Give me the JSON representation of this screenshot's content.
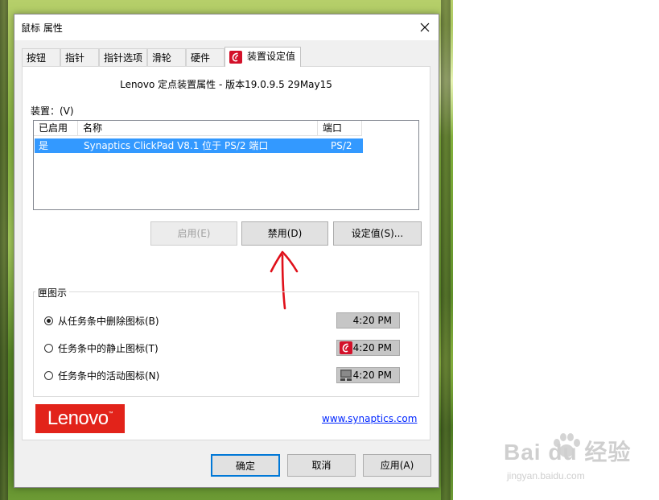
{
  "window": {
    "title": "鼠标 属性",
    "close_glyph": "✕"
  },
  "tabs": [
    {
      "label": "按钮"
    },
    {
      "label": "指针"
    },
    {
      "label": "指针选项"
    },
    {
      "label": "滑轮"
    },
    {
      "label": "硬件"
    },
    {
      "label": "装置设定值",
      "icon": "synaptics-icon",
      "active": true
    }
  ],
  "version_text": "Lenovo 定点装置属性 - 版本19.0.9.5 29May15",
  "devices": {
    "label": "装置：(V)",
    "columns": [
      "已启用",
      "名称",
      "端口"
    ],
    "rows": [
      {
        "enabled": "是",
        "name": "Synaptics ClickPad V8.1 位于 PS/2 端口",
        "port": "PS/2",
        "selected": true
      }
    ]
  },
  "device_buttons": {
    "enable": "启用(E)",
    "disable": "禁用(D)",
    "settings": "设定值(S)..."
  },
  "tray_group": {
    "title": "匣图示",
    "options": [
      {
        "label": "从任务条中删除图标(B)",
        "checked": true,
        "time": "4:20 PM",
        "icon": ""
      },
      {
        "label": "任务条中的静止图标(T)",
        "checked": false,
        "time": "4:20 PM",
        "icon": "synaptics-icon"
      },
      {
        "label": "任务条中的活动图标(N)",
        "checked": false,
        "time": "4:20 PM",
        "icon": "touchpad-icon"
      }
    ]
  },
  "brand": {
    "logo_text": "Lenovo",
    "logo_color": "#e2231a",
    "link": "www.synaptics.com"
  },
  "footer_buttons": {
    "ok": "确定",
    "cancel": "取消",
    "apply": "应用(A)"
  },
  "colors": {
    "selection": "#3399ff",
    "annotation_arrow": "#e0101a",
    "default_button_border": "#0078d7"
  },
  "watermark": {
    "main": "Bai du 经验",
    "sub": "jingyan.baidu.com"
  }
}
